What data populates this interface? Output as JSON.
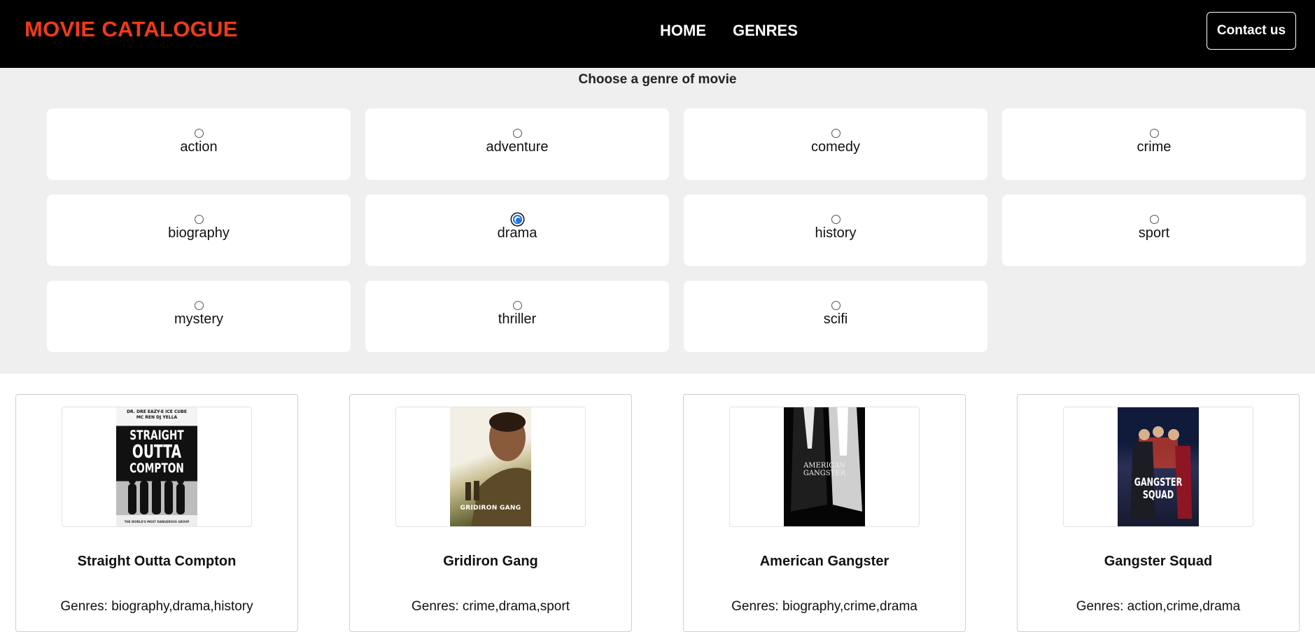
{
  "header": {
    "brand": "MOVIE CATALOGUE",
    "nav": [
      {
        "label": "HOME"
      },
      {
        "label": "GENRES"
      }
    ],
    "contact_label": "Contact us",
    "colors": {
      "background": "#000000",
      "brand": "#f03a17",
      "text": "#ffffff"
    }
  },
  "genre_picker": {
    "title": "Choose a genre of movie",
    "selected": "drama",
    "options": [
      {
        "label": "action",
        "checked": false
      },
      {
        "label": "adventure",
        "checked": false
      },
      {
        "label": "comedy",
        "checked": false
      },
      {
        "label": "crime",
        "checked": false
      },
      {
        "label": "biography",
        "checked": false
      },
      {
        "label": "drama",
        "checked": true
      },
      {
        "label": "history",
        "checked": false
      },
      {
        "label": "sport",
        "checked": false
      },
      {
        "label": "mystery",
        "checked": false
      },
      {
        "label": "thriller",
        "checked": false
      },
      {
        "label": "scifi",
        "checked": false
      }
    ]
  },
  "movies": [
    {
      "title": "Straight Outta Compton",
      "genres": "Genres: biography,drama,history",
      "poster": {
        "credits": "DR. DRE  EAZY-E  ICE CUBE\nMC REN  DJ YELLA",
        "title_lines": [
          "STRAIGHT",
          "OUTTA",
          "COMPTON"
        ],
        "footer": "THE WORLD'S MOST DANGEROUS GROUP"
      }
    },
    {
      "title": "Gridiron Gang",
      "genres": "Genres: crime,drama,sport",
      "poster": {
        "title_lines": [
          "GRIDIRON GANG"
        ]
      }
    },
    {
      "title": "American Gangster",
      "genres": "Genres: biography,crime,drama",
      "poster": {
        "title_lines": [
          "AMERICAN",
          "GANGSTER"
        ]
      }
    },
    {
      "title": "Gangster Squad",
      "genres": "Genres: action,crime,drama",
      "poster": {
        "title_lines": [
          "GANGSTER",
          "SQUAD"
        ]
      }
    }
  ]
}
